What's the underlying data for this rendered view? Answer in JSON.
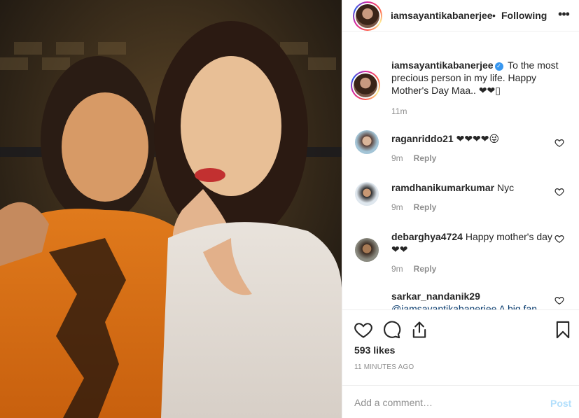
{
  "post": {
    "username": "iamsayantikabanerjee",
    "follow_separator": "•",
    "follow_label": "Following",
    "more_icon": "more-horizontal-icon"
  },
  "caption": {
    "username": "iamsayantikabanerjee",
    "text": "To the most precious person in my life. Happy Mother's Day Maa.. ❤❤▯",
    "time": "11m"
  },
  "comments": [
    {
      "username": "raganriddo21",
      "text": "❤❤❤❤😜",
      "time": "9m",
      "reply": "Reply"
    },
    {
      "username": "ramdhanikumarkumar",
      "text": "Nyc",
      "time": "9m",
      "reply": "Reply"
    },
    {
      "username": "debarghya4724",
      "text": "Happy mother's day❤❤",
      "time": "9m",
      "reply": "Reply"
    },
    {
      "username": "sarkar_nandanik29",
      "text": "@iamsayantikabanerjee A big fan",
      "time": "",
      "reply": ""
    }
  ],
  "actions": {
    "like_icon": "heart-icon",
    "comment_icon": "comment-icon",
    "share_icon": "share-icon",
    "save_icon": "bookmark-icon"
  },
  "likes": "593 likes",
  "timestamp": "11 MINUTES AGO",
  "comment_input": {
    "placeholder": "Add a comment…",
    "value": ""
  },
  "post_button": "Post",
  "colors": {
    "verified": "#3897f0",
    "secondary_text": "#8e8e8e",
    "post_button_disabled": "#b2dffc"
  }
}
